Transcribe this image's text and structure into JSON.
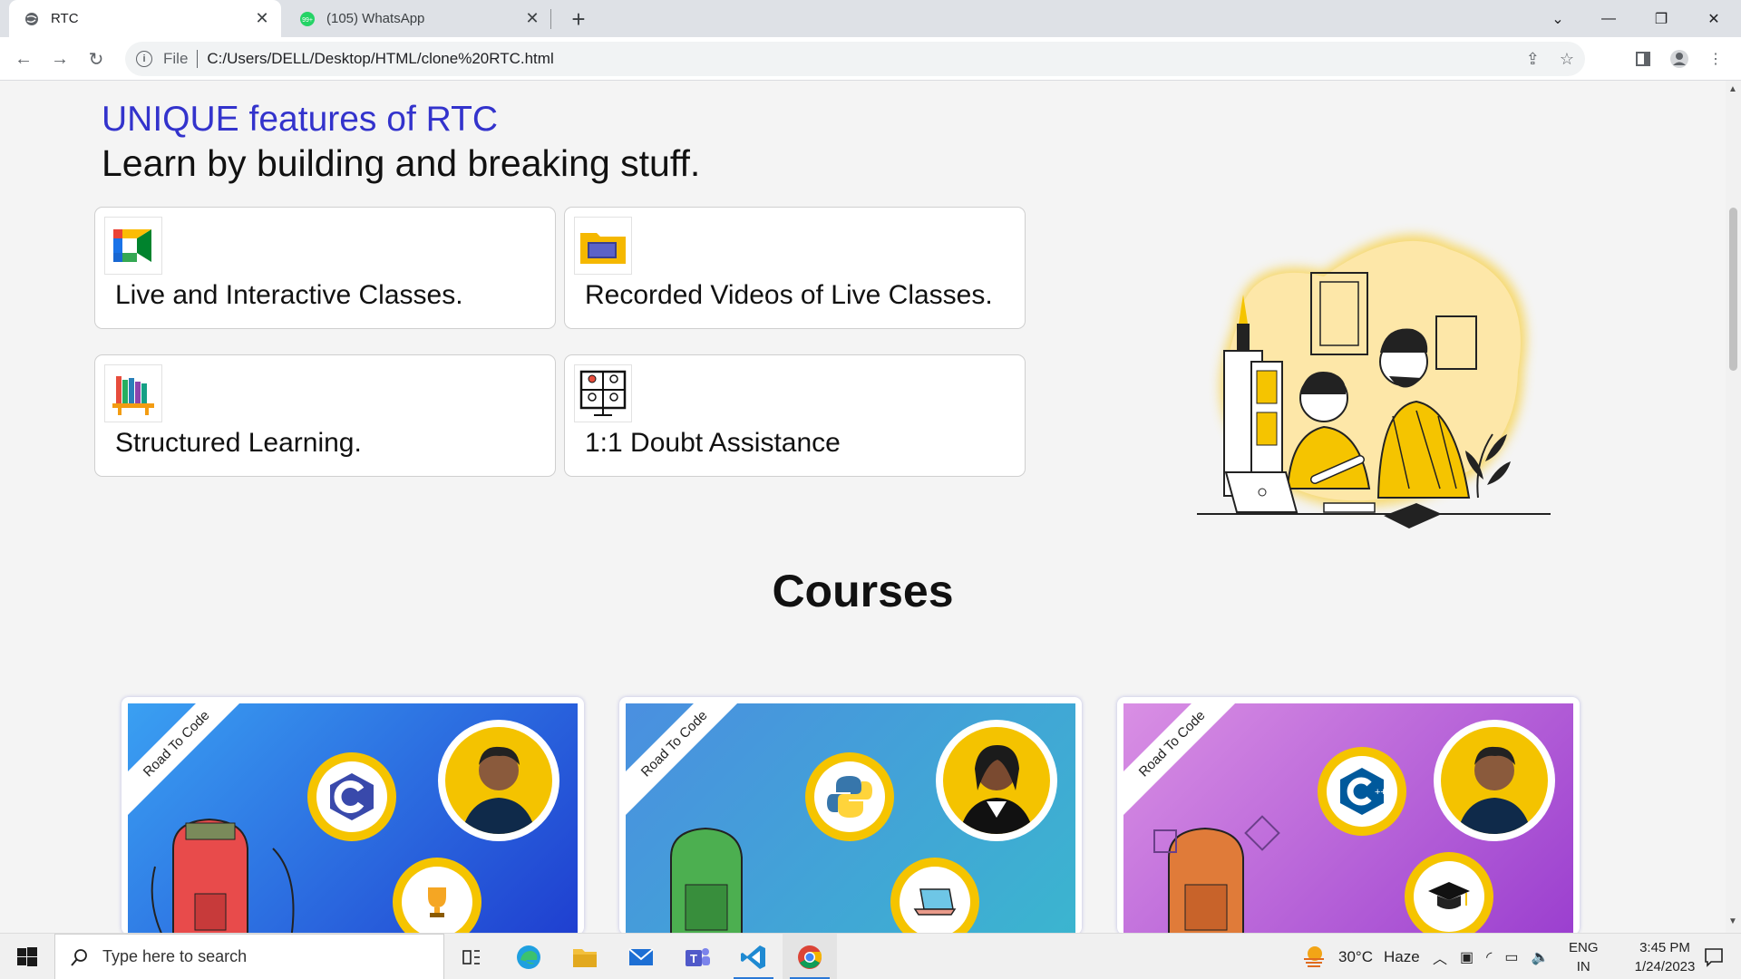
{
  "browser": {
    "tabs": [
      {
        "title": "RTC",
        "icon": "globe-icon",
        "active": true
      },
      {
        "title": "(105) WhatsApp",
        "icon": "whatsapp-icon",
        "badge": "99+",
        "active": false
      }
    ],
    "new_tab": "+",
    "address": {
      "scheme_label": "File",
      "url": "C:/Users/DELL/Desktop/HTML/clone%20RTC.html"
    }
  },
  "page": {
    "unique_heading": "UNIQUE features of RTC",
    "tagline": "Learn by building and breaking stuff.",
    "features": [
      {
        "label": "Live and Interactive Classes.",
        "icon": "google-meet-icon"
      },
      {
        "label": "Recorded Videos of Live Classes.",
        "icon": "video-folder-icon"
      },
      {
        "label": "Structured Learning.",
        "icon": "bookshelf-icon"
      },
      {
        "label": "1:1 Doubt Assistance",
        "icon": "video-call-grid-icon"
      }
    ],
    "courses_heading": "Courses",
    "courses": [
      {
        "ribbon": "Road To Code",
        "language": "C",
        "gradient": [
          "#3aa0f2",
          "#1f3fd0"
        ]
      },
      {
        "ribbon": "Road To Code",
        "language": "Python",
        "gradient": [
          "#4a8fe0",
          "#3bb5cf"
        ]
      },
      {
        "ribbon": "Road To Code",
        "language": "C++",
        "gradient": [
          "#d98fe4",
          "#9b3fcf"
        ]
      }
    ]
  },
  "taskbar": {
    "search_placeholder": "Type here to search",
    "weather": {
      "temp": "30°C",
      "condition": "Haze"
    },
    "language": {
      "line1": "ENG",
      "line2": "IN"
    },
    "time": "3:45 PM",
    "date": "1/24/2023"
  },
  "colors": {
    "accent_heading": "#3333cc",
    "page_bg": "#f4f4f4",
    "badge_yellow": "#f5c400"
  }
}
